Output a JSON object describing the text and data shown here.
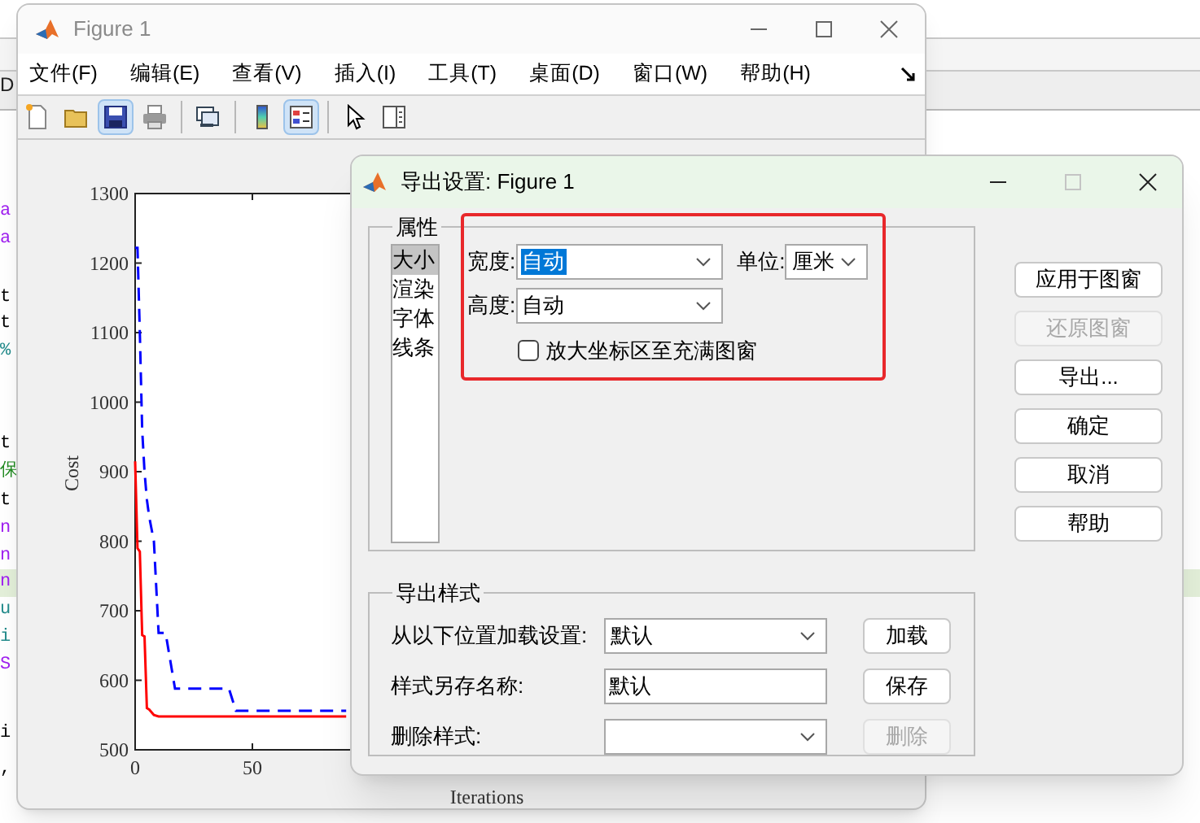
{
  "editor": {
    "tab": "D",
    "lines": [
      {
        "text": "a",
        "color": "#a020f0",
        "current": false
      },
      {
        "text": "a",
        "color": "#a020f0",
        "current": false
      },
      {
        "text": "t",
        "color": "#000000",
        "current": false
      },
      {
        "text": "t",
        "color": "#000000",
        "current": false
      },
      {
        "text": "%",
        "color": "#228b8b",
        "current": false
      },
      {
        "text": "t",
        "color": "#000000",
        "current": false
      },
      {
        "text": "保",
        "color": "#228b22",
        "current": false
      },
      {
        "text": "t",
        "color": "#000000",
        "current": false
      },
      {
        "text": "n",
        "color": "#a020f0",
        "current": false
      },
      {
        "text": "n",
        "color": "#a020f0",
        "current": false
      },
      {
        "text": "n",
        "color": "#a020f0",
        "current": true
      },
      {
        "text": "u",
        "color": "#228b8b",
        "current": false
      },
      {
        "text": "i",
        "color": "#228b8b",
        "current": false
      },
      {
        "text": "S",
        "color": "#a020f0",
        "current": false
      },
      {
        "text": "i",
        "color": "#000000",
        "current": false
      },
      {
        "text": ",",
        "color": "#000000",
        "current": false
      }
    ]
  },
  "figure_window": {
    "title": "Figure 1",
    "active": false,
    "menu": [
      "文件(F)",
      "编辑(E)",
      "查看(V)",
      "插入(I)",
      "工具(T)",
      "桌面(D)",
      "窗口(W)",
      "帮助(H)"
    ],
    "toolbar": [
      {
        "kind": "new",
        "pressed": false
      },
      {
        "kind": "open",
        "pressed": false
      },
      {
        "kind": "save",
        "pressed": true
      },
      {
        "kind": "print",
        "pressed": false
      },
      {
        "kind": "separator"
      },
      {
        "kind": "link",
        "pressed": false
      },
      {
        "kind": "separator"
      },
      {
        "kind": "colorbar",
        "pressed": false
      },
      {
        "kind": "legend",
        "pressed": true
      },
      {
        "kind": "separator"
      },
      {
        "kind": "pointer",
        "pressed": false
      },
      {
        "kind": "panel",
        "pressed": false
      }
    ],
    "chart_data": {
      "type": "line",
      "xlabel": "Iterations",
      "ylabel": "Cost",
      "x": [
        0,
        1,
        2,
        3,
        4,
        5,
        6,
        8,
        10,
        13,
        17,
        40,
        43,
        60,
        90
      ],
      "series": [
        {
          "color": "#ff0000",
          "line_style": "solid",
          "values": [
            915,
            790,
            785,
            665,
            663,
            560,
            558,
            550,
            548,
            548,
            548,
            548,
            548,
            548,
            548
          ]
        },
        {
          "color": "#0000ff",
          "line_style": "dashed",
          "values": [
            1222,
            1222,
            1100,
            960,
            900,
            860,
            835,
            800,
            668,
            668,
            588,
            588,
            556,
            556,
            556
          ]
        }
      ],
      "xlim": [
        0,
        300
      ],
      "ylim": [
        500,
        1300
      ],
      "xticks": [
        0,
        50
      ],
      "yticks": [
        500,
        600,
        700,
        800,
        900,
        1000,
        1100,
        1200,
        1300
      ]
    }
  },
  "dialog": {
    "title": "导出设置: Figure 1",
    "properties": {
      "legend": "属性",
      "list": [
        {
          "label": "大小",
          "selected": true
        },
        {
          "label": "渲染",
          "selected": false
        },
        {
          "label": "字体",
          "selected": false
        },
        {
          "label": "线条",
          "selected": false
        }
      ],
      "width_label": "宽度:",
      "width_value": "自动",
      "width_value_selected": true,
      "unit_label": "单位:",
      "unit_value": "厘米",
      "height_label": "高度:",
      "height_value": "自动",
      "checkbox": {
        "label": "放大坐标区至充满图窗",
        "checked": false
      }
    },
    "buttons": [
      {
        "label": "应用于图窗",
        "disabled": false
      },
      {
        "label": "还原图窗",
        "disabled": true
      },
      {
        "label": "导出...",
        "disabled": false
      },
      {
        "label": "确定",
        "disabled": false
      },
      {
        "label": "取消",
        "disabled": false
      },
      {
        "label": "帮助",
        "disabled": false
      }
    ],
    "export_styles": {
      "legend": "导出样式",
      "rows": [
        {
          "label": "从以下位置加载设置:",
          "kind": "dropdown",
          "value": "默认",
          "button": "加载",
          "button_disabled": false
        },
        {
          "label": "样式另存名称:",
          "kind": "input",
          "value": "默认",
          "button": "保存",
          "button_disabled": false
        },
        {
          "label": "删除样式:",
          "kind": "dropdown",
          "button": "删除",
          "button_disabled": true
        }
      ]
    }
  }
}
